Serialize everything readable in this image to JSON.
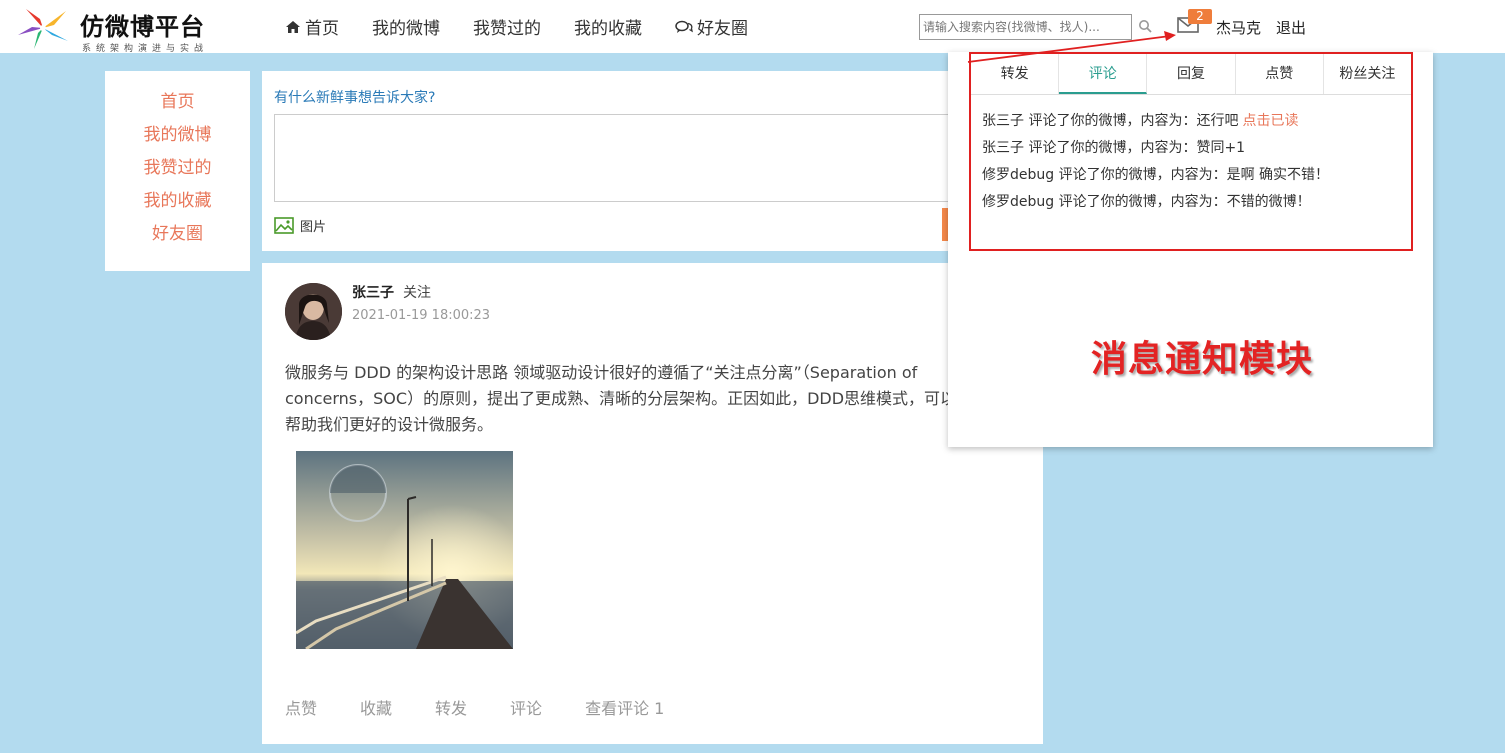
{
  "header": {
    "logo": {
      "title": "仿微博平台",
      "subtitle": "系统架构演进与实战"
    },
    "nav": [
      {
        "label": "首页",
        "icon": "home-icon"
      },
      {
        "label": "我的微博"
      },
      {
        "label": "我赞过的"
      },
      {
        "label": "我的收藏"
      },
      {
        "label": "好友圈",
        "icon": "chat-icon"
      }
    ],
    "search": {
      "placeholder": "请输入搜索内容(找微博、找人)..."
    },
    "mail_badge": "2",
    "username": "杰马克",
    "logout": "退出"
  },
  "sidebar": {
    "items": [
      "首页",
      "我的微博",
      "我赞过的",
      "我的收藏",
      "好友圈"
    ]
  },
  "composer": {
    "prompt": "有什么新鲜事想告诉大家?",
    "picture_label": "图片"
  },
  "post": {
    "author": "张三子",
    "follow": "关注",
    "time": "2021-01-19 18:00:23",
    "body": "微服务与 DDD 的架构设计思路 领域驱动设计很好的遵循了“关注点分离”（Separation of concerns，SOC）的原则，提出了更成熟、清晰的分层架构。正因如此，DDD思维模式，可以帮助我们更好的设计微服务。",
    "actions": [
      "点赞",
      "收藏",
      "转发",
      "评论",
      "查看评论 1"
    ]
  },
  "notifications": {
    "tabs": [
      "转发",
      "评论",
      "回复",
      "点赞",
      "粉丝关注"
    ],
    "active_tab": "评论",
    "items": [
      {
        "text": "张三子 评论了你的微博，内容为：还行吧",
        "action": "点击已读"
      },
      {
        "text": "张三子 评论了你的微博，内容为：赞同+1"
      },
      {
        "text": "修罗debug 评论了你的微博，内容为：是啊 确实不错！"
      },
      {
        "text": "修罗debug 评论了你的微博，内容为：不错的微博！"
      }
    ],
    "annotation": "消息通知模块"
  },
  "colors": {
    "background": "#b3dbef",
    "accent_orange": "#ef7d3b",
    "link_red": "#e8775a",
    "tab_active": "#2a9d8f",
    "highlight_border": "#e02020"
  }
}
